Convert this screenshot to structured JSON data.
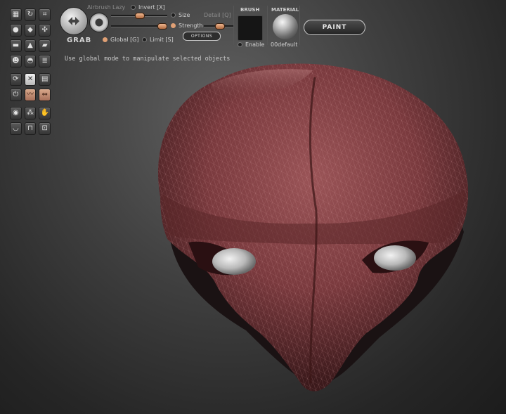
{
  "toolbar": {
    "tool_name": "GRAB",
    "airbrush_label": "Airbrush",
    "lazy_label": "Lazy",
    "invert_label": "Invert [X]",
    "size_label": "Size",
    "detail_label": "Detail [Q]",
    "strength_label": "Strength",
    "global_label": "Global [G]",
    "limit_label": "Limit [S]",
    "options_label": "OPTIONS",
    "brush_heading": "BRUSH",
    "brush_enable_label": "Enable",
    "material_heading": "MATERIAL",
    "material_name": "00default",
    "paint_label": "PAINT",
    "size_value": 0.62,
    "strength_value": 0.62,
    "detail_value": 0.5
  },
  "hint_text": "Use global mode to manipulate selected objects",
  "tool_icons": [
    [
      "select-icon",
      "rotate-icon",
      "crop-icon"
    ],
    [
      "sphere-icon",
      "blob-icon",
      "mesh-icon"
    ],
    [
      "smooth-icon",
      "sculpt-icon",
      "move-icon"
    ],
    [
      "person-icon",
      "terrain-icon",
      "layers-icon"
    ],
    [
      "refresh-icon",
      "close-box-icon",
      "grid-icon"
    ],
    [
      "power-icon",
      "wave-icon",
      "arrows-icon"
    ],
    [
      "ball-icon",
      "dots-icon",
      "grab-icon"
    ],
    [
      "bowl-icon",
      "flatten-icon",
      "cylinder-icon"
    ]
  ],
  "colors": {
    "accent": "#e0a075",
    "mesh": "#7d3c40",
    "background": "#3f3f3f"
  }
}
